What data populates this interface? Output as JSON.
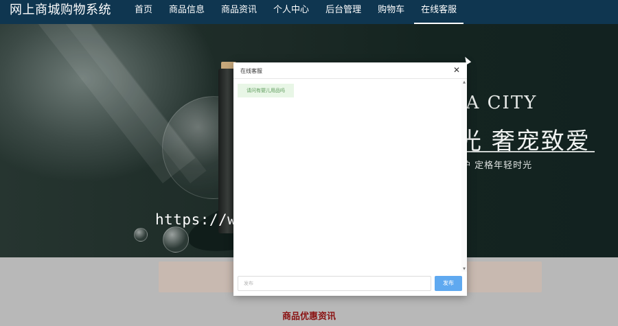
{
  "header": {
    "site_title": "网上商城购物系统",
    "nav": [
      {
        "label": "首页",
        "active": false
      },
      {
        "label": "商品信息",
        "active": false
      },
      {
        "label": "商品资讯",
        "active": false
      },
      {
        "label": "个人中心",
        "active": false
      },
      {
        "label": "后台管理",
        "active": false
      },
      {
        "label": "购物车",
        "active": false
      },
      {
        "label": "在线客服",
        "active": true
      }
    ]
  },
  "banner": {
    "headline_en": "MA CITY",
    "headline_cn": "光 奢宠致爱",
    "subline_cn": "护  定格年轻时光"
  },
  "watermark": "https://www.huzhan.com/ishop3572",
  "section": {
    "title": "商品优惠资讯"
  },
  "chat_dialog": {
    "title": "在线客服",
    "messages": [
      {
        "text": "请问有婴儿用品吗"
      }
    ],
    "input_placeholder": "发布",
    "input_value": "",
    "send_label": "发布",
    "close_icon": "close-icon"
  },
  "colors": {
    "nav_bg": "#0f3650",
    "send_button": "#5fa9f0",
    "message_bg": "#e8f6e6",
    "section_title": "#8a1212"
  }
}
